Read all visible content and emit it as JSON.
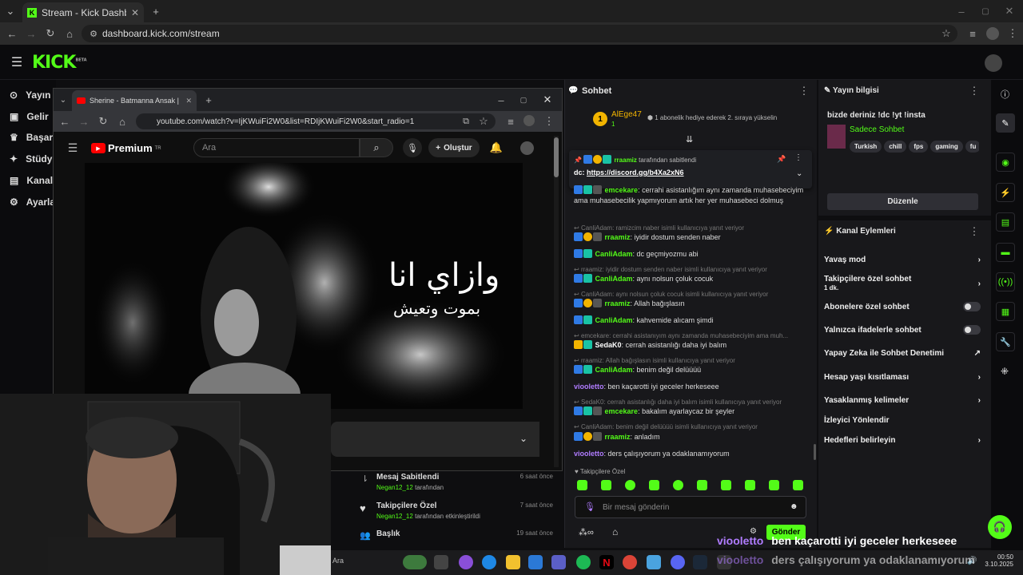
{
  "browser": {
    "tab_title": "Stream - Kick Dashboard",
    "url": "dashboard.kick.com/stream"
  },
  "kick": {
    "logo": "KICK",
    "logo_badge": "BETA",
    "nav": [
      "Yayın",
      "Gelir",
      "Başarı",
      "Stüdy",
      "Kanal",
      "Ayarla"
    ]
  },
  "youtube": {
    "tab_title": "Sherine - Batmanna Ansak | ش...",
    "url": "youtube.com/watch?v=IjKWuiFi2W0&list=RDIjKWuiFi2W0&start_radio=1",
    "logo": "Premium",
    "logo_sup": "TR",
    "search_placeholder": "Ara",
    "create_label": "Oluştur",
    "video_text_main": "وازاي انا",
    "video_text_sub": "بموت وتعيش"
  },
  "notifications": [
    {
      "title": "Mesaj Sabitlendi",
      "sub_user": "Negan12_12",
      "sub_text": "tarafından",
      "time": "6 saat önce",
      "icon": "pin-icon"
    },
    {
      "title": "Takipçilere Özel",
      "sub_user": "Negan12_12",
      "sub_text": "tarafından etkinleştirildi",
      "time": "7 saat önce",
      "icon": "heart-icon"
    },
    {
      "title": "Başlık",
      "sub_user": "",
      "sub_text": "",
      "time": "19 saat önce",
      "icon": "users-icon"
    }
  ],
  "chat": {
    "title": "Sohbet",
    "sub_gift_user": "AlEge47",
    "sub_gift_count": "1",
    "sub_gift_text": "1 abonelik hediye ederek 2. sıraya yükselin",
    "pinned_by_user": "rraamiz",
    "pinned_by_text": "tarafından sabitlendi",
    "pinned_prefix": "dc:",
    "pinned_link": "https://discord.gg/b4Xa2xN6",
    "messages": [
      {
        "reply": "",
        "user": "emcekare",
        "ucls": "u-green",
        "text": "cerrahi asistanlığım aynı zamanda muhasebeciyim ama muhasebecilik yapmıyorum artık her yer muhasebeci dolmuş"
      },
      {
        "reply": "CanliAdam: ramizcim naber isimli kullanıcıya yanıt veriyor",
        "user": "rraamiz",
        "ucls": "u-green",
        "text": "iyidir dostum senden naber"
      },
      {
        "reply": "",
        "user": "CanliAdam",
        "ucls": "u-green",
        "text": "dc geçmiyozmu abi"
      },
      {
        "reply": "rraamiz: iyidir dostum senden naber isimli kullanıcıya yanıt veriyor",
        "user": "CanliAdam",
        "ucls": "u-green",
        "text": "aynı nolsun çoluk cocuk"
      },
      {
        "reply": "CanliAdam: aynı nolsun çoluk cocuk isimli kullanıcıya yanıt veriyor",
        "user": "rraamiz",
        "ucls": "u-green",
        "text": "Allah bağışlasın"
      },
      {
        "reply": "",
        "user": "CanliAdam",
        "ucls": "u-green",
        "text": "kahvemide alıcam şimdi"
      },
      {
        "reply": "emcekare: cerrahi asistanıyım aynı zamanda muhasebeciyim ama muh...",
        "user": "SedaK0",
        "ucls": "u-white",
        "text": "cerrah asistanlığı daha iyi balım"
      },
      {
        "reply": "rraamiz: Allah bağışlasın isimli kullanıcıya yanıt veriyor",
        "user": "CanliAdam",
        "ucls": "u-green",
        "text": "benim değil delüüüü"
      },
      {
        "reply": "",
        "user": "viooletto",
        "ucls": "u-purple",
        "text": "ben kaçarotti iyi geceler herkeseee"
      },
      {
        "reply": "SedaK0: cerrah asistanlığı daha iyi balım isimli kullanıcıya yanıt veriyor",
        "user": "emcekare",
        "ucls": "u-green",
        "text": "bakalım ayarlaycaz bir şeyler"
      },
      {
        "reply": "CanliAdam: benim değil delüüüü isimli kullanıcıya yanıt veriyor",
        "user": "rraamiz",
        "ucls": "u-green",
        "text": "anladım"
      },
      {
        "reply": "",
        "user": "viooletto",
        "ucls": "u-purple",
        "text": "ders çalışıyorum ya odaklanamıyorum"
      }
    ],
    "followers_only_label": "Takipçilere Özel",
    "input_placeholder": "Bir mesaj gönderin",
    "send_label": "Gönder"
  },
  "stream_info": {
    "title": "Yayın bilgisi",
    "stream_title": "bizde deriniz !dc !yt !insta",
    "category": "Sadece Sohbet",
    "tags": [
      "Turkish",
      "chill",
      "fps",
      "gaming",
      "fu"
    ],
    "edit_label": "Düzenle"
  },
  "channel_actions": {
    "title": "Kanal Eylemleri",
    "items": [
      {
        "label": "Yavaş mod",
        "sub": "",
        "control": "chevron"
      },
      {
        "label": "Takipçilere özel sohbet",
        "sub": "1 dk.",
        "control": "chevron"
      },
      {
        "label": "Abonelere özel sohbet",
        "sub": "",
        "control": "toggle"
      },
      {
        "label": "Yalnızca ifadelerle sohbet",
        "sub": "",
        "control": "toggle"
      },
      {
        "label": "Yapay Zeka ile Sohbet Denetimi",
        "sub": "",
        "control": "external"
      },
      {
        "label": "Hesap yaşı kısıtlaması",
        "sub": "",
        "control": "chevron"
      },
      {
        "label": "Yasaklanmış kelimeler",
        "sub": "",
        "control": "chevron"
      },
      {
        "label": "İzleyici Yönlendir",
        "sub": "",
        "control": "none"
      },
      {
        "label": "Hedefleri belirleyin",
        "sub": "",
        "control": "chevron"
      }
    ]
  },
  "overlay": {
    "line1_user": "viooletto",
    "line1_text": "ben kaçarotti iyi geceler herkeseee",
    "line2_user": "viooletto",
    "line2_text": "ders çalışıyorum ya odaklanamıyorum"
  },
  "taskbar": {
    "search_placeholder": "Ara",
    "time": "00:50",
    "date": "3.10.2025"
  },
  "colors": {
    "accent": "#53fc18",
    "panel": "#18181b",
    "bg": "#0e0e10"
  }
}
